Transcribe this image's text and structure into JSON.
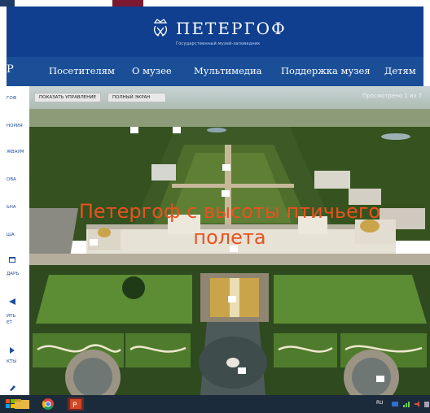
{
  "header": {
    "logo_title": "ПЕТЕРГОФ",
    "logo_subtitle": "Государственный музей-заповедник"
  },
  "nav": {
    "edge_glyph": "Р",
    "items": [
      {
        "label": "Посетителям"
      },
      {
        "label": "О музее"
      },
      {
        "label": "Мультимедиа"
      },
      {
        "label": "Поддержка музея"
      },
      {
        "label": "Детям"
      }
    ]
  },
  "sidebar": {
    "items": [
      {
        "label": "ГОФ"
      },
      {
        "label": "НОРИЯ"
      },
      {
        "label": "ЖВАУМ"
      },
      {
        "label": "ОВА"
      },
      {
        "label": "ЬНА"
      },
      {
        "label": "ША"
      },
      {
        "label": "ДАРЬ",
        "icon": "calendar-icon"
      },
      {
        "label": "ИТЬ",
        "icon": "ticket-icon"
      },
      {
        "label": "ЕТ"
      },
      {
        "label": "КТЫ",
        "icon": "contacts-icon"
      }
    ]
  },
  "viewer": {
    "show_controls_label": "ПОКАЗАТЬ УПРАВЛЕНИЕ",
    "fullscreen_label": "ПОЛНЫЙ ЭКРАН",
    "counter": "Просмотрено 1 из 7",
    "title_line1": "Петергоф с высоты птичьего",
    "title_line2": "полета"
  },
  "taskbar": {
    "language": "RU",
    "apps": [
      "explorer-icon",
      "chrome-icon",
      "powerpoint-icon"
    ]
  },
  "colors": {
    "header_blue": "#0f3f8e",
    "nav_blue": "#1a4f98",
    "title_orange": "#e8531f",
    "sidebar_text": "#1f4e9a"
  }
}
